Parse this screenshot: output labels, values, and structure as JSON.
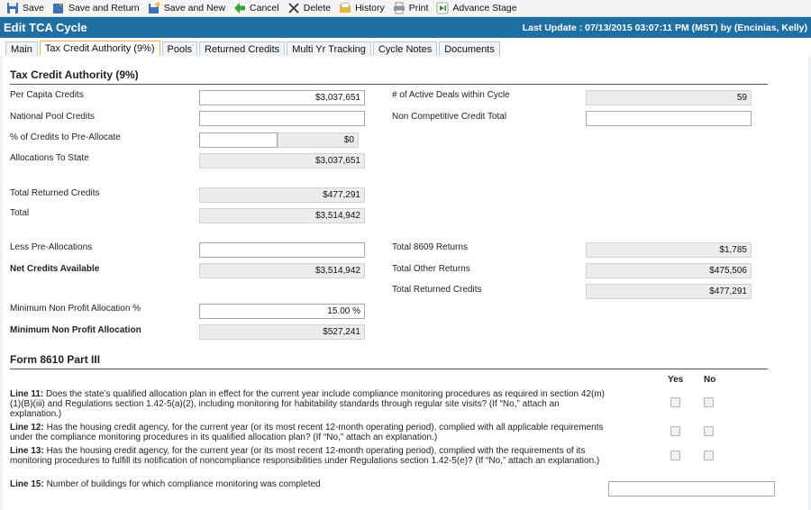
{
  "toolbar": {
    "save": "Save",
    "save_return": "Save and Return",
    "save_new": "Save and New",
    "cancel": "Cancel",
    "delete": "Delete",
    "history": "History",
    "print": "Print",
    "advance_stage": "Advance Stage"
  },
  "header": {
    "title": "Edit TCA Cycle",
    "last_update": "Last Update : 07/13/2015 03:07:11 PM (MST) by (Encinias, Kelly)"
  },
  "tabs": [
    {
      "label": "Main"
    },
    {
      "label": "Tax Credit Authority (9%)"
    },
    {
      "label": "Pools"
    },
    {
      "label": "Returned Credits"
    },
    {
      "label": "Multi Yr Tracking"
    },
    {
      "label": "Cycle Notes"
    },
    {
      "label": "Documents"
    }
  ],
  "tca": {
    "section_title": "Tax Credit Authority (9%)",
    "per_capita_label": "Per Capita Credits",
    "per_capita_value": "$3,037,651",
    "national_pool_label": "National Pool Credits",
    "national_pool_value": "",
    "pct_preallocate_label": "% of Credits to Pre-Allocate",
    "pct_preallocate_value": "",
    "pct_preallocate_amount": "$0",
    "alloc_state_label": "Allocations To State",
    "alloc_state_value": "$3,037,651",
    "total_returned_label": "Total Returned Credits",
    "total_returned_value": "$477,291",
    "total_label": "Total",
    "total_value": "$3,514,942",
    "less_prealloc_label": "Less Pre-Allocations",
    "less_prealloc_value": "",
    "net_available_label": "Net Credits Available",
    "net_available_value": "$3,514,942",
    "min_np_pct_label": "Minimum Non Profit Allocation %",
    "min_np_pct_value": "15.00 %",
    "min_np_label": "Minimum Non Profit Allocation",
    "min_np_value": "$527,241",
    "active_deals_label": "# of Active Deals within Cycle",
    "active_deals_value": "59",
    "non_comp_label": "Non Competitive Credit Total",
    "non_comp_value": "",
    "total_8609_label": "Total 8609 Returns",
    "total_8609_value": "$1,785",
    "total_other_label": "Total Other Returns",
    "total_other_value": "$475,506",
    "total_returned_right_label": "Total Returned Credits",
    "total_returned_right_value": "$477,291"
  },
  "form8610": {
    "section_title": "Form 8610 Part III",
    "yes_label": "Yes",
    "no_label": "No",
    "line11_tag": "Line 11:",
    "line11_text": "Does the state’s qualified allocation plan in effect for the current year include compliance monitoring procedures as required in section 42(m)(1)(B)(iii) and Regulations section 1.42-5(a)(2), including monitoring for habitability standards through regular site visits? (If “No,” attach an explanation.)",
    "line12_tag": "Line 12:",
    "line12_text": "Has the housing credit agency, for the current year (or its most recent 12-month operating period), complied with all applicable requirements under the compliance monitoring procedures in its qualified allocation plan? (If “No,” attach an explanation.)",
    "line13_tag": "Line 13:",
    "line13_text": "Has the housing credit agency, for the current year (or its most recent 12-month operating period), complied with the requirements of its monitoring procedures to fulfill its notification of noncompliance responsibilities under Regulations section 1.42-5(e)? (If “No,” attach an explanation.)",
    "line15_tag": "Line 15:",
    "line15_text": "Number of buildings for which compliance monitoring was completed",
    "line15_value": ""
  }
}
